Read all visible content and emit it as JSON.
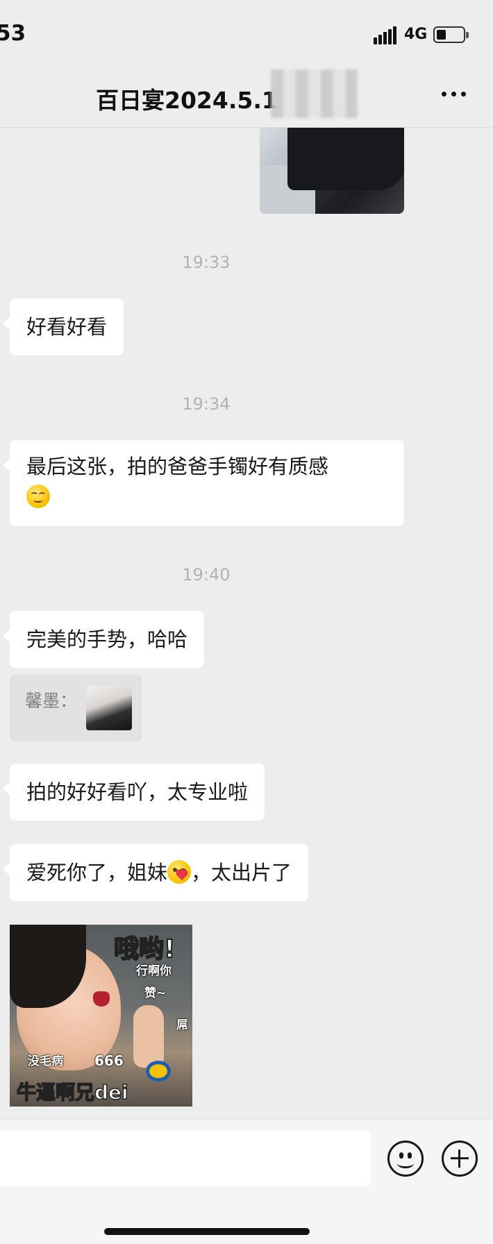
{
  "status_bar": {
    "time": "53",
    "network": "4G"
  },
  "header": {
    "title": "百日宴2024.5.1"
  },
  "timestamps": [
    "19:33",
    "19:34",
    "19:40"
  ],
  "messages": [
    {
      "text": "好看好看"
    },
    {
      "text": "最后这张，拍的爸爸手镯好有质感",
      "emoji": "relieved-face"
    },
    {
      "text": "完美的手势，哈哈"
    },
    {
      "text_before": "爱死你了，姐妹",
      "emoji": "face-blowing-kiss",
      "text_after": "，太出片了"
    },
    {
      "text": "拍的好好看吖，太专业啦"
    }
  ],
  "quote": {
    "sender": "馨墨："
  },
  "sticker": {
    "big_text": "哦哟!",
    "line1": "行啊你",
    "line2": "赞~",
    "line3": "屌",
    "line4": "没毛病",
    "line5": "666",
    "bottom_text": "牛逼啊兄dei"
  },
  "input": {
    "value": "",
    "placeholder": ""
  },
  "colors": {
    "background": "#ededed",
    "bubble": "#ffffff",
    "timestamp": "#b2b2b2"
  }
}
